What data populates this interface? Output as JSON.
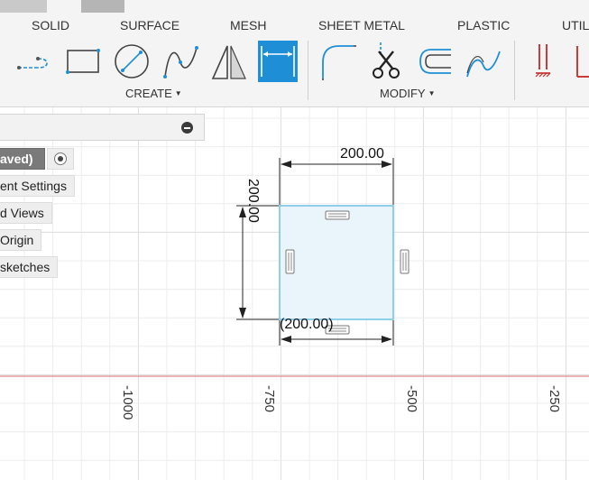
{
  "toolbar": {
    "tabs": [
      "SOLID",
      "SURFACE",
      "MESH",
      "SHEET METAL",
      "PLASTIC",
      "UTIL"
    ],
    "groups": {
      "create_label": "CREATE",
      "modify_label": "MODIFY"
    },
    "tools": {
      "create": [
        "line-icon",
        "rectangle-icon",
        "circle-icon",
        "spline-icon",
        "mirror-triangle-icon",
        "sketch-dimension-icon"
      ],
      "modify": [
        "fillet-icon",
        "trim-scissors-icon",
        "offset-icon",
        "fit-point-spline-icon"
      ],
      "constraints": [
        "constraint-icon",
        "construction-icon"
      ]
    },
    "active_tool": "sketch-dimension-icon",
    "accent_color": "#1e8fd6"
  },
  "browser": {
    "root_label": "aved)",
    "items": [
      "ent Settings",
      "d Views",
      "Origin",
      "sketches"
    ]
  },
  "sketch": {
    "dim_horizontal": "200.00",
    "dim_vertical": "200.00",
    "dim_driven": "(200.00)"
  },
  "axis": {
    "ticks": [
      "-1000",
      "-750",
      "-500",
      "-250"
    ],
    "axis_color": "#e08a8a"
  }
}
